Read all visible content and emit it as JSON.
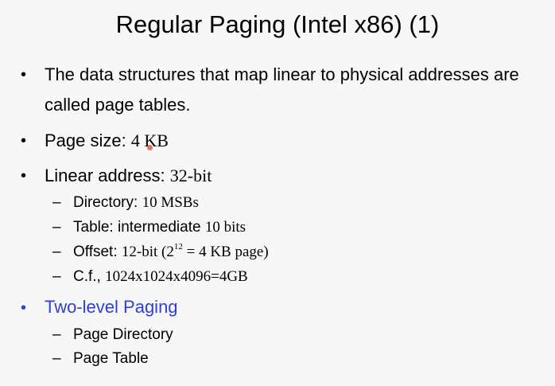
{
  "title": "Regular Paging (Intel x86) (1)",
  "bullets": [
    {
      "line1": "The data structures that map linear to physical addresses are",
      "line2": "called page tables."
    },
    {
      "label": "Page size: ",
      "value": "4 KB"
    },
    {
      "label": "Linear address: ",
      "value": "32-bit",
      "sub": [
        {
          "label": "Directory: ",
          "value": "10 MSBs"
        },
        {
          "label": "Table: intermediate ",
          "value": "10 bits"
        },
        {
          "label": "Offset: ",
          "value_pre": "12-bit (2",
          "exp": "12",
          "value_post": " = 4 KB page)"
        },
        {
          "label": "C.f., ",
          "value": "1024x1024x4096=4GB"
        }
      ]
    },
    {
      "label": "Two-level Paging",
      "sub": [
        {
          "label": "Page Directory"
        },
        {
          "label": "Page Table"
        }
      ]
    }
  ],
  "bullet_symbol": "•",
  "dash_symbol": "–",
  "colors": {
    "background": "#f7f7f7",
    "text": "#000000",
    "highlight_bullet": "#2e3fd6",
    "cursor": "#e85a4a"
  }
}
